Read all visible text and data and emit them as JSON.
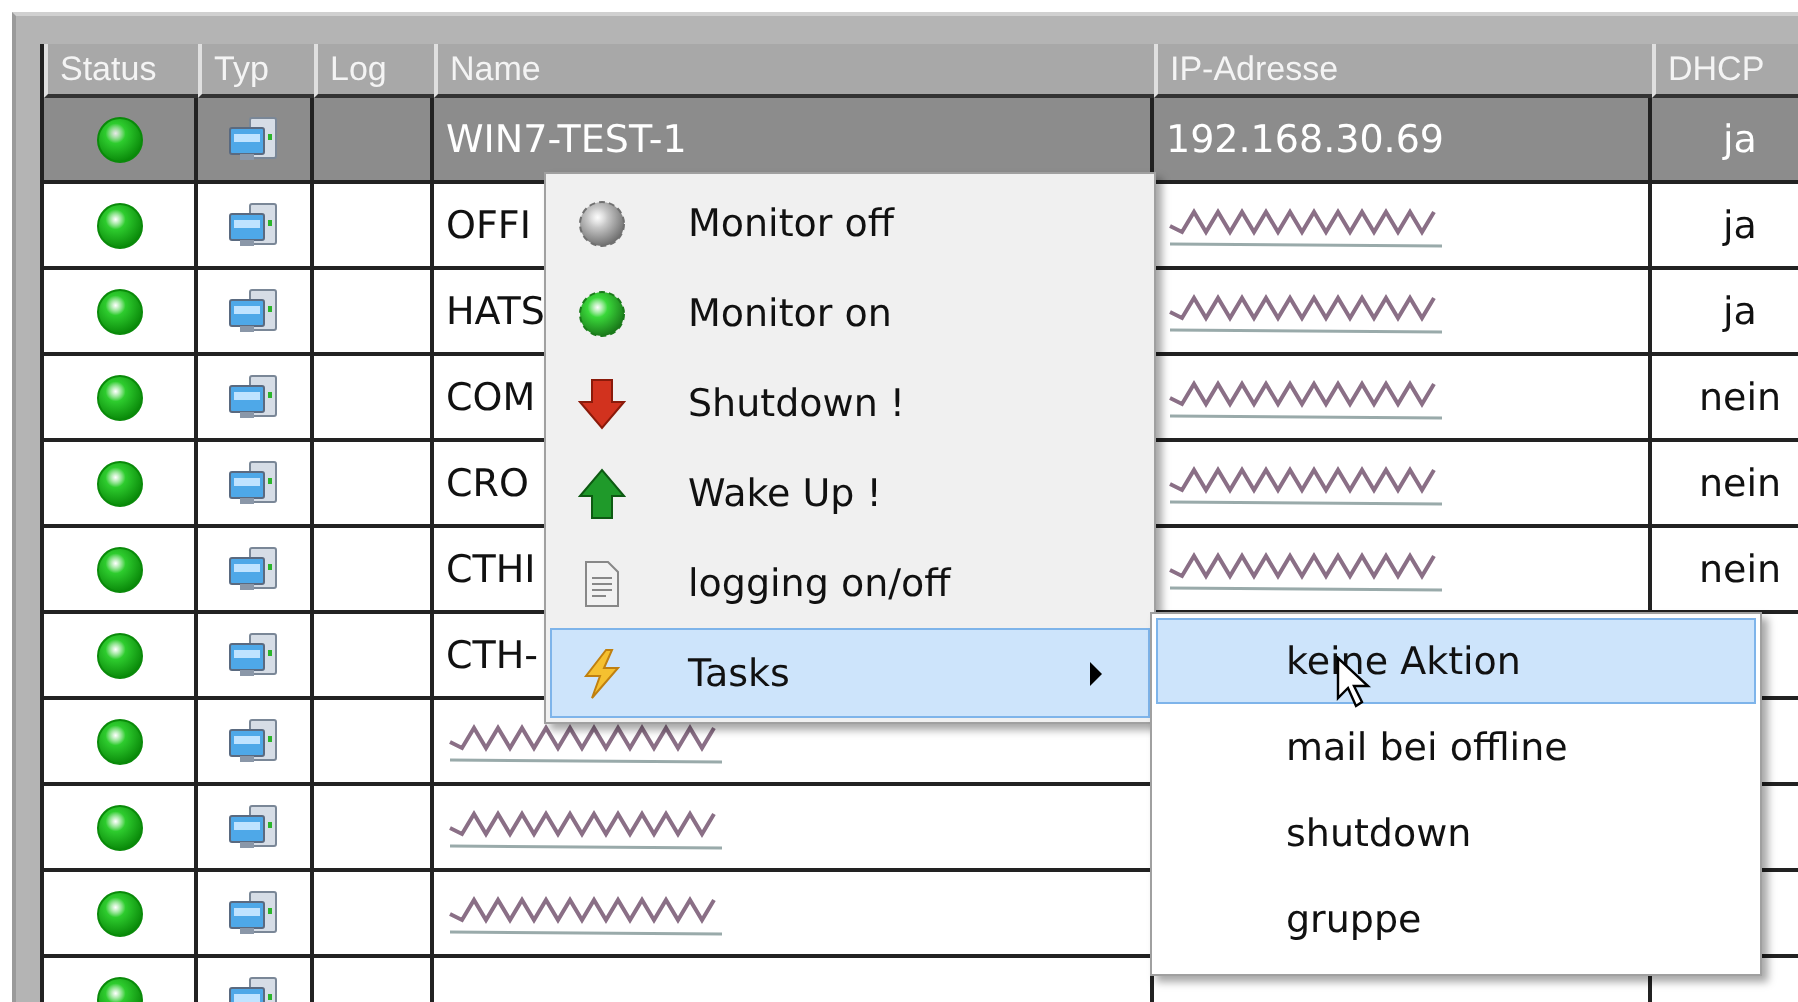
{
  "table": {
    "columns": [
      "Status",
      "Typ",
      "Log",
      "Name",
      "IP-Adresse",
      "DHCP"
    ],
    "rows": [
      {
        "selected": true,
        "name": "WIN7-TEST-1",
        "name_redacted": false,
        "ip": "192.168.30.69",
        "ip_redacted": false,
        "dhcp": "ja"
      },
      {
        "selected": false,
        "name": "OFFI",
        "name_redacted": false,
        "ip_redacted": true,
        "dhcp": "ja"
      },
      {
        "selected": false,
        "name": "HATS",
        "name_redacted": false,
        "ip_redacted": true,
        "dhcp": "ja"
      },
      {
        "selected": false,
        "name": "COM",
        "name_redacted": false,
        "ip_redacted": true,
        "dhcp": "nein"
      },
      {
        "selected": false,
        "name": "CRO",
        "name_redacted": false,
        "ip_redacted": true,
        "dhcp": "nein"
      },
      {
        "selected": false,
        "name": "CTHI",
        "name_redacted": false,
        "ip_redacted": true,
        "dhcp": "nein"
      },
      {
        "selected": false,
        "name": "CTH-",
        "name_redacted": false
      },
      {
        "selected": false,
        "name_redacted": true
      },
      {
        "selected": false,
        "name_redacted": true
      },
      {
        "selected": false,
        "name_redacted": true
      },
      {
        "selected": false,
        "name_redacted": false
      }
    ]
  },
  "context_menu": {
    "items": [
      {
        "label": "Monitor off",
        "kind": "dot-off",
        "selected": false,
        "has_submenu": false
      },
      {
        "label": "Monitor on",
        "kind": "dot-on",
        "selected": false,
        "has_submenu": false
      },
      {
        "label": "Shutdown !",
        "kind": "arrow-down",
        "selected": false,
        "has_submenu": false
      },
      {
        "label": "Wake Up !",
        "kind": "arrow-up",
        "selected": false,
        "has_submenu": false
      },
      {
        "label": "logging on/off",
        "kind": "document",
        "selected": false,
        "has_submenu": false
      },
      {
        "label": "Tasks",
        "kind": "lightning",
        "selected": true,
        "has_submenu": true
      }
    ]
  },
  "submenu": {
    "items": [
      {
        "label": "keine Aktion",
        "selected": true
      },
      {
        "label": "mail bei offline",
        "selected": false
      },
      {
        "label": "shutdown",
        "selected": false
      },
      {
        "label": "gruppe",
        "selected": false
      }
    ]
  }
}
